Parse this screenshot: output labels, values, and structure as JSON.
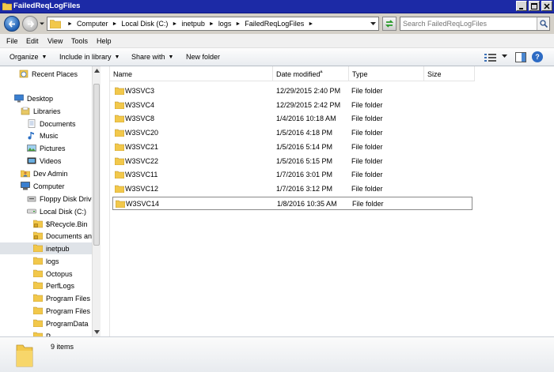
{
  "window": {
    "title": "FailedReqLogFiles"
  },
  "address": {
    "crumbs": [
      "Computer",
      "Local Disk (C:)",
      "inetpub",
      "logs",
      "FailedReqLogFiles"
    ],
    "search_placeholder": "Search FailedReqLogFiles"
  },
  "menu": {
    "items": [
      "File",
      "Edit",
      "View",
      "Tools",
      "Help"
    ]
  },
  "commands": {
    "organize": "Organize",
    "include": "Include in library",
    "share": "Share with",
    "new_folder": "New folder",
    "help": "?"
  },
  "nav": {
    "items": [
      {
        "label": "Recent Places",
        "icon": "recent-places-icon"
      },
      {
        "label": "Desktop",
        "icon": "desktop-icon"
      },
      {
        "label": "Libraries",
        "icon": "libraries-icon"
      },
      {
        "label": "Documents",
        "icon": "documents-icon"
      },
      {
        "label": "Music",
        "icon": "music-icon"
      },
      {
        "label": "Pictures",
        "icon": "pictures-icon"
      },
      {
        "label": "Videos",
        "icon": "videos-icon"
      },
      {
        "label": "Dev Admin",
        "icon": "user-folder-icon"
      },
      {
        "label": "Computer",
        "icon": "computer-icon"
      },
      {
        "label": "Floppy Disk Drive",
        "icon": "floppy-icon"
      },
      {
        "label": "Local Disk (C:)",
        "icon": "hard-disk-icon"
      },
      {
        "label": "$Recycle.Bin",
        "icon": "locked-folder-icon"
      },
      {
        "label": "Documents and",
        "icon": "locked-folder-icon"
      },
      {
        "label": "inetpub",
        "icon": "folder-icon"
      },
      {
        "label": "logs",
        "icon": "folder-icon"
      },
      {
        "label": "Octopus",
        "icon": "folder-icon"
      },
      {
        "label": "PerfLogs",
        "icon": "folder-icon"
      },
      {
        "label": "Program Files",
        "icon": "folder-icon"
      },
      {
        "label": "Program Files (",
        "icon": "folder-icon"
      },
      {
        "label": "ProgramData",
        "icon": "folder-icon"
      },
      {
        "label": "P",
        "icon": "folder-icon"
      }
    ]
  },
  "columns": {
    "name": "Name",
    "date": "Date modified",
    "type": "Type",
    "size": "Size"
  },
  "files": [
    {
      "name": "W3SVC3",
      "date": "12/29/2015 2:40 PM",
      "type": "File folder"
    },
    {
      "name": "W3SVC4",
      "date": "12/29/2015 2:42 PM",
      "type": "File folder"
    },
    {
      "name": "W3SVC8",
      "date": "1/4/2016 10:18 AM",
      "type": "File folder"
    },
    {
      "name": "W3SVC20",
      "date": "1/5/2016 4:18 PM",
      "type": "File folder"
    },
    {
      "name": "W3SVC21",
      "date": "1/5/2016 5:14 PM",
      "type": "File folder"
    },
    {
      "name": "W3SVC22",
      "date": "1/5/2016 5:15 PM",
      "type": "File folder"
    },
    {
      "name": "W3SVC11",
      "date": "1/7/2016 3:01 PM",
      "type": "File folder"
    },
    {
      "name": "W3SVC12",
      "date": "1/7/2016 3:12 PM",
      "type": "File folder"
    },
    {
      "name": "W3SVC14",
      "date": "1/8/2016 10:35 AM",
      "type": "File folder"
    }
  ],
  "status": {
    "count": "9 items"
  },
  "colors": {
    "titlebar": "#1c2aa6",
    "folder": "#f2c84b",
    "selection": "#dfe3e8"
  }
}
